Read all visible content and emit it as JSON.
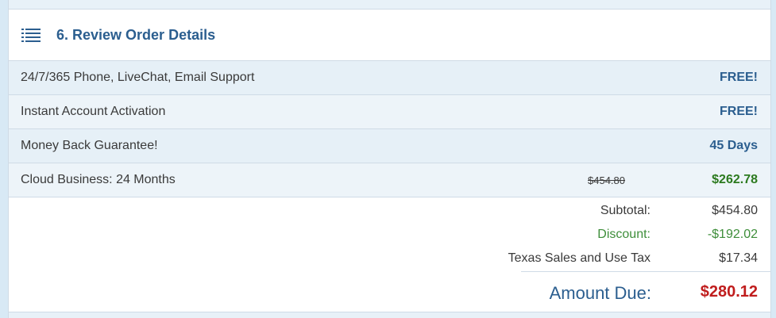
{
  "section": {
    "title": "6. Review Order Details",
    "icon": "list-icon",
    "accent_color": "#2b5e8f"
  },
  "items": [
    {
      "label": "24/7/365 Phone, LiveChat, Email Support",
      "value": "FREE!"
    },
    {
      "label": "Instant Account Activation",
      "value": "FREE!"
    },
    {
      "label": "Money Back Guarantee!",
      "value": "45 Days"
    },
    {
      "label": "Cloud Business: 24 Months",
      "original_price": "$454.80",
      "value": "$262.78"
    }
  ],
  "summary": {
    "subtotal_label": "Subtotal:",
    "subtotal_value": "$454.80",
    "discount_label": "Discount:",
    "discount_value": "-$192.02",
    "tax_label": "Texas Sales and Use Tax",
    "tax_value": "$17.34",
    "amount_due_label": "Amount Due:",
    "amount_due_value": "$280.12",
    "amount_due_color": "#c01d1d"
  }
}
